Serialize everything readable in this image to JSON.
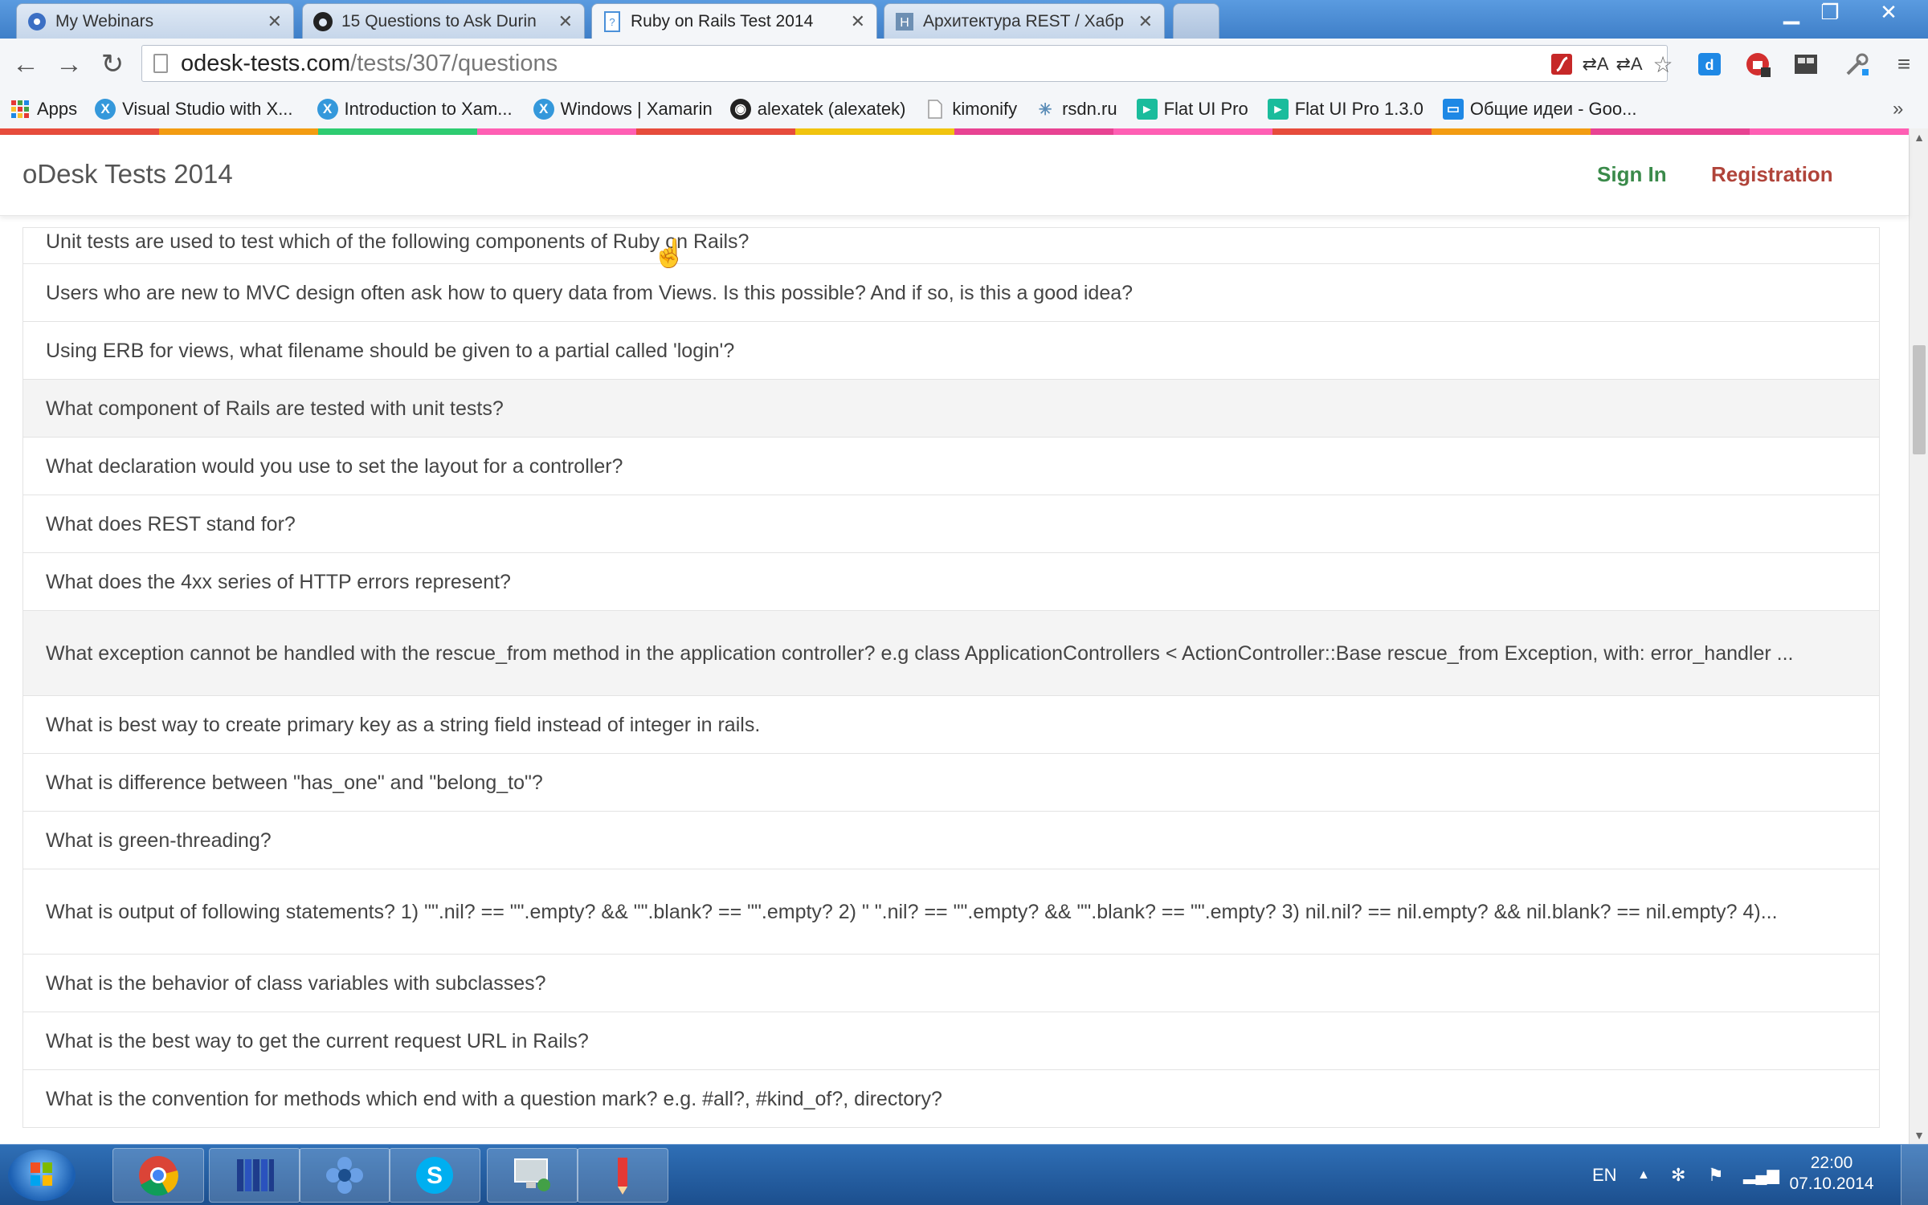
{
  "browser": {
    "tabs": [
      {
        "title": "My Webinars",
        "icon": "gear-flower-icon"
      },
      {
        "title": "15 Questions to Ask Durin",
        "icon": "github-icon"
      },
      {
        "title": "Ruby on Rails Test 2014",
        "icon": "page-icon"
      },
      {
        "title": "Архитектура REST / Хабр",
        "icon": "habr-icon"
      }
    ],
    "url_host": "odesk-tests.com",
    "url_path": "/tests/307/questions",
    "bookmarks": [
      {
        "label": "Apps",
        "icon": "apps-grid-icon"
      },
      {
        "label": "Visual Studio with X...",
        "icon": "xamarin-icon"
      },
      {
        "label": "Introduction to Xam...",
        "icon": "xamarin-icon"
      },
      {
        "label": "Windows | Xamarin",
        "icon": "xamarin-icon"
      },
      {
        "label": "alexatek (alexatek)",
        "icon": "github-icon"
      },
      {
        "label": "kimonify",
        "icon": "page-icon"
      },
      {
        "label": "rsdn.ru",
        "icon": "rsdn-icon"
      },
      {
        "label": "Flat UI Pro",
        "icon": "flat-ui-icon"
      },
      {
        "label": "Flat UI Pro 1.3.0",
        "icon": "flat-ui-icon"
      },
      {
        "label": "Общие идеи - Goo...",
        "icon": "slides-icon"
      }
    ]
  },
  "site": {
    "brand": "oDesk Tests 2014",
    "sign_in": "Sign In",
    "registration": "Registration"
  },
  "questions": [
    "Unit tests are used to test which of the following components of Ruby on Rails?",
    "Users who are new to MVC design often ask how to query data from Views. Is this possible? And if so, is this a good idea?",
    "Using ERB for views, what filename should be given to a partial called 'login'?",
    "What component of Rails are tested with unit tests?",
    "What declaration would you use to set the layout for a controller?",
    "What does REST stand for?",
    "What does the 4xx series of HTTP errors represent?",
    "What exception cannot be handled with the rescue_from method in the application controller? e.g class ApplicationControllers < ActionController::Base rescue_from Exception, with: error_handler ...",
    "What is best way to create primary key as a string field instead of integer in rails.",
    "What is difference between \"has_one\" and \"belong_to\"?",
    "What is green-threading?",
    "What is output of following statements? 1) \"\".nil? == \"\".empty? && \"\".blank? == \"\".empty? 2) \" \".nil? == \"\".empty? && \"\".blank? == \"\".empty? 3) nil.nil? == nil.empty? && nil.blank? == nil.empty? 4)...",
    "What is the behavior of class variables with subclasses?",
    "What is the best way to get the current request URL in Rails?",
    "What is the convention for methods which end with a question mark? e.g. #all?, #kind_of?, directory?"
  ],
  "taskbar": {
    "language": "EN",
    "time": "22:00",
    "date": "07.10.2014",
    "apps": [
      "chrome-icon",
      "library-icon",
      "gear-flower-icon",
      "skype-icon",
      "remote-desktop-icon",
      "pencil-icon"
    ]
  },
  "colors": {
    "sign_in": "#3a8a4a",
    "registration": "#b0443a",
    "rainbow": [
      "#e74c3c",
      "#f39c12",
      "#2ecc71",
      "#ff5fb4",
      "#e74c3c",
      "#f1c40f",
      "#e84393",
      "#ff5fb4",
      "#e74c3c",
      "#f39c12",
      "#e84393",
      "#ff5fb4"
    ]
  }
}
